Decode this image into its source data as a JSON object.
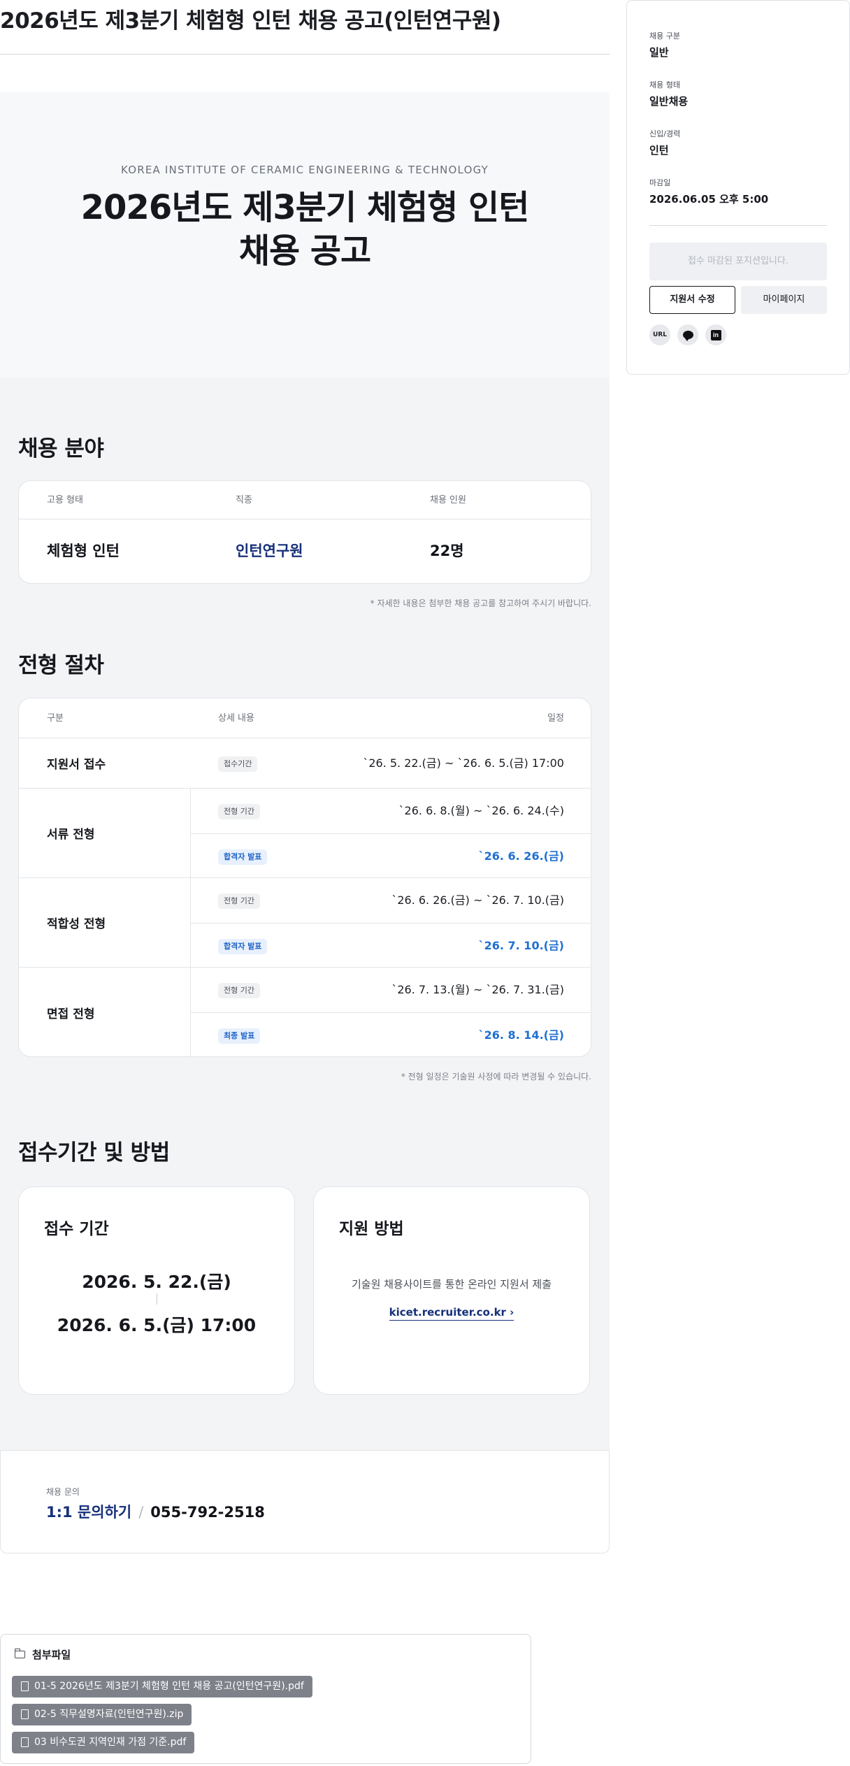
{
  "page": {
    "title": "2026년도 제3분기 체험형 인턴 채용 공고(인턴연구원)"
  },
  "hero": {
    "subtitle": "KOREA INSTITUTE OF CERAMIC ENGINEERING & TECHNOLOGY",
    "title_line1": "2026년도 제3분기 체험형 인턴",
    "title_line2": "채용 공고"
  },
  "recruit": {
    "title": "채용 분야",
    "headers": [
      "고용 형태",
      "직종",
      "채용 인원"
    ],
    "row": {
      "type": "체험형 인턴",
      "job": "인턴연구원",
      "count": "22명"
    },
    "note": "* 자세한 내용은 첨부한 채용 공고를 참고하여 주시기 바랍니다."
  },
  "process": {
    "title": "전형 절차",
    "headers": [
      "구분",
      "상세 내용",
      "일정"
    ],
    "groups": [
      {
        "label": "지원서 접수",
        "items": [
          {
            "tag": "접수기간",
            "date": "`26. 5. 22.(금) ~ `26. 6. 5.(금) 17:00"
          }
        ]
      },
      {
        "label": "서류 전형",
        "items": [
          {
            "tag": "전형 기간",
            "date": "`26. 6. 8.(월) ~ `26. 6. 24.(수)"
          },
          {
            "tag": "합격자 발표",
            "date": "`26. 6. 26.(금)"
          }
        ]
      },
      {
        "label": "적합성 전형",
        "items": [
          {
            "tag": "전형 기간",
            "date": "`26. 6. 26.(금) ~ `26. 7. 10.(금)"
          },
          {
            "tag": "합격자 발표",
            "date": "`26. 7. 10.(금)"
          }
        ]
      },
      {
        "label": "면접 전형",
        "items": [
          {
            "tag": "전형 기간",
            "date": "`26. 7. 13.(월) ~ `26. 7. 31.(금)"
          },
          {
            "tag": "최종 발표",
            "date": "`26. 8. 14.(금)"
          }
        ]
      }
    ],
    "note": "* 전형 일정은 기술원 사정에 따라 변경될 수 있습니다."
  },
  "period": {
    "title": "접수기간 및 방법",
    "period_card": {
      "title": "접수 기간",
      "start": "2026. 5. 22.(금)",
      "end": "2026. 6. 5.(금) 17:00"
    },
    "method_card": {
      "title": "지원 방법",
      "text": "기술원 채용사이트를 통한 온라인 지원서 제출",
      "link": "kicet.recruiter.co.kr ›"
    }
  },
  "inquiry": {
    "label": "채용 문의",
    "link": "1:1 문의하기",
    "slash": "/",
    "phone": "055-792-2518"
  },
  "attachments": {
    "title": "첨부파일",
    "files": [
      "01-5 2026년도 제3분기 체험형 인턴 채용 공고(인턴연구원).pdf",
      "02-5 직무설명자료(인턴연구원).zip",
      "03 비수도권 지역인재 가점 기준.pdf"
    ]
  },
  "sidebar": {
    "category_label": "채용 구분",
    "category_value": "일반",
    "form_label": "채용 형태",
    "form_value": "일반채용",
    "career_label": "신입/경력",
    "career_value": "인턴",
    "deadline_label": "마감일",
    "deadline_value": "2026.06.05 오후 5:00",
    "closed_text": "접수 마감된 포지션입니다.",
    "edit_button": "지원서 수정",
    "mypage_button": "마이페이지",
    "share_url": "URL",
    "share_linkedin": "in"
  }
}
